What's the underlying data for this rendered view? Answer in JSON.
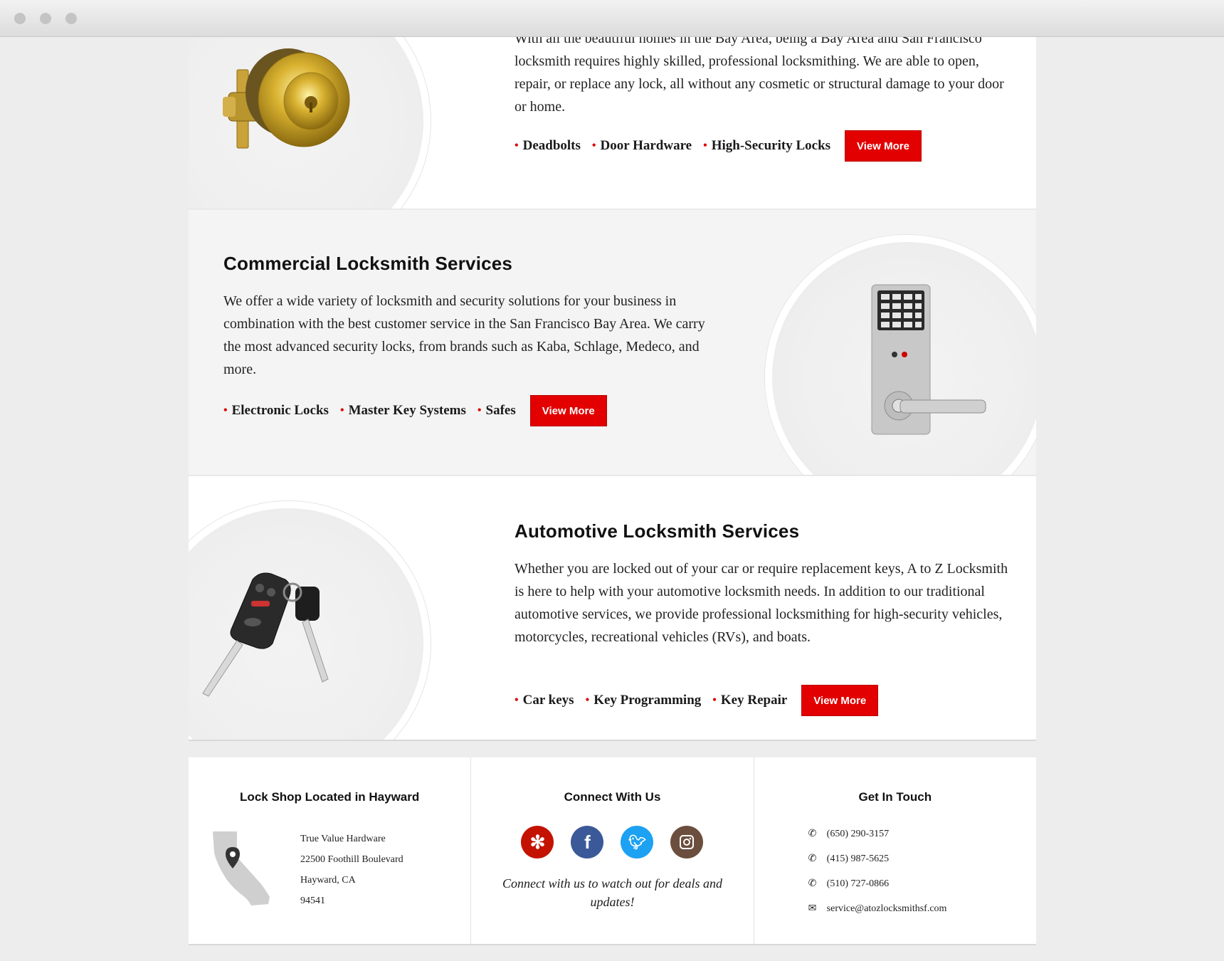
{
  "residential": {
    "text_partial": "With all the beautiful homes in the Bay Area, being a Bay Area and San Francisco locksmith requires highly skilled, professional locksmithing. We are able to open, repair, or replace any lock, all without any cosmetic or structural damage to your door or home.",
    "tags": [
      "Deadbolts",
      "Door Hardware",
      "High-Security Locks"
    ],
    "button": "View More"
  },
  "commercial": {
    "title": "Commercial Locksmith Services",
    "text": "We offer a wide variety of locksmith and security solutions for your business in combination with the best customer service in the San Francisco Bay Area. We carry the most advanced security locks, from brands such as Kaba, Schlage, Medeco, and more.",
    "tags": [
      "Electronic Locks",
      "Master Key Systems",
      "Safes"
    ],
    "button": "View More"
  },
  "automotive": {
    "title": "Automotive Locksmith Services",
    "text": "Whether you are locked out of your car or require replacement keys, A to Z Locksmith is here to help with your automotive locksmith needs. In addition to our traditional automotive services, we provide professional locksmithing for high-security vehicles, motorcycles, recreational vehicles (RVs), and boats.",
    "tags": [
      "Car keys",
      "Key Programming",
      "Key Repair"
    ],
    "button": "View More"
  },
  "footer": {
    "location": {
      "heading": "Lock Shop Located in Hayward",
      "lines": [
        "True Value Hardware",
        "22500 Foothill Boulevard",
        "Hayward, CA",
        "94541"
      ]
    },
    "connect": {
      "heading": "Connect With Us",
      "tagline": "Connect with us to watch out for deals and updates!",
      "icons": [
        "yelp-icon",
        "facebook-icon",
        "twitter-icon",
        "instagram-icon"
      ]
    },
    "contact": {
      "heading": "Get In Touch",
      "phones": [
        "(650) 290-3157",
        "(415) 987-5625",
        "(510) 727-0866"
      ],
      "email": "service@atozlocksmithsf.com"
    }
  },
  "colors": {
    "accent": "#e20000",
    "yelp": "#c41200",
    "facebook": "#3b5998",
    "twitter": "#1da1f2",
    "instagram": "#6b4e3d"
  }
}
